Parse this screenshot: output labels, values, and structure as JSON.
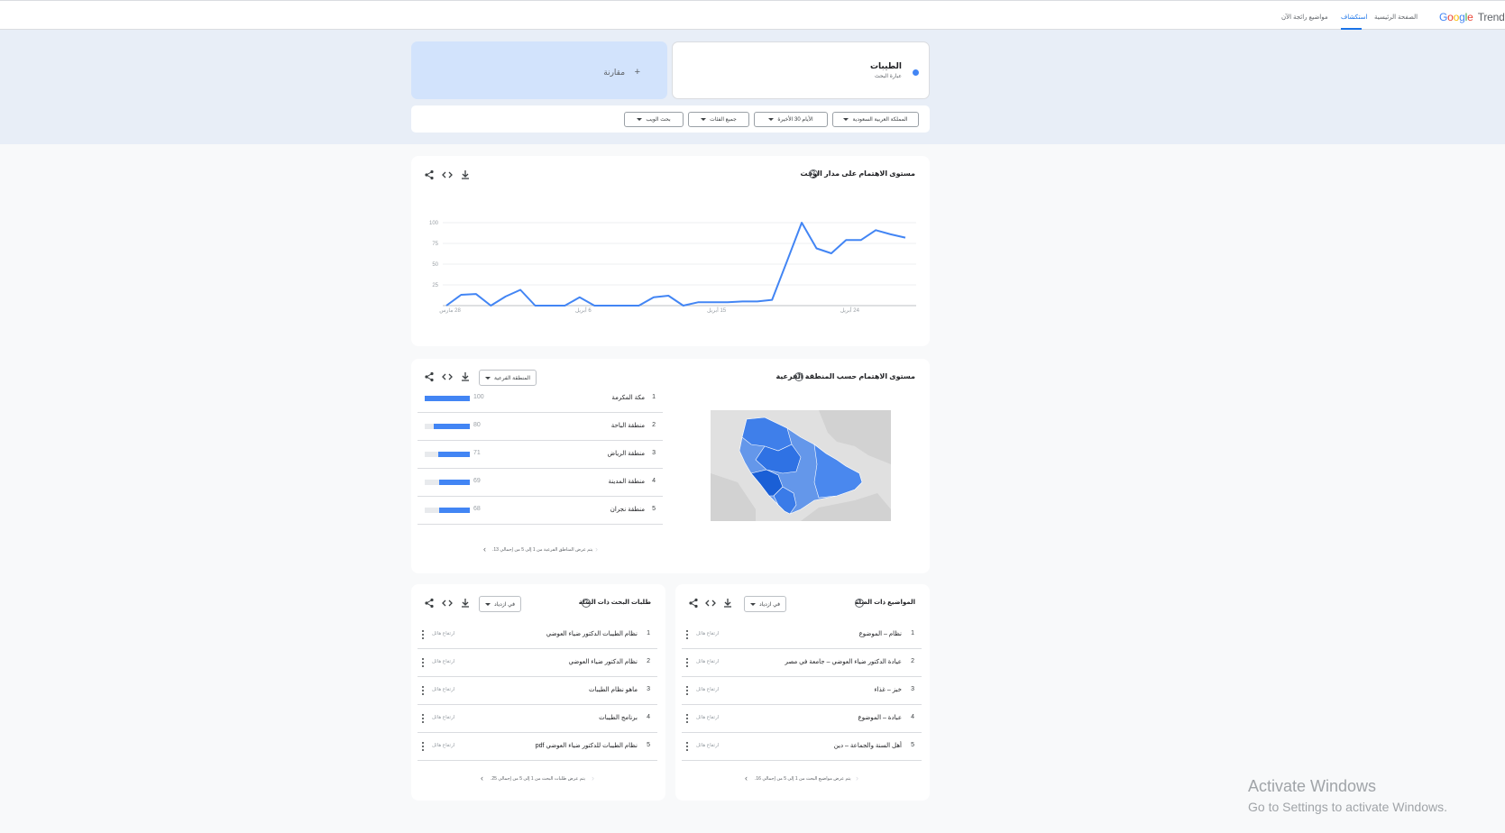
{
  "header": {
    "logo": {
      "google": "Google",
      "trends": "Trends"
    },
    "tabs": [
      {
        "label": "الصفحة الرئيسية"
      },
      {
        "label": "استكشاف",
        "active": true
      },
      {
        "label": "مواضيع رائجة الآن"
      }
    ],
    "accent_color": "#1a73e8"
  },
  "search_term": {
    "name": "الطيبات",
    "subtitle": "عبارة البحث",
    "color": "#4285f4"
  },
  "compare": {
    "icon": "plus-icon",
    "label": "مقارنة"
  },
  "filters": [
    {
      "label": "المملكة العربية السعودية"
    },
    {
      "label": "الأيام 30 الأخيرة"
    },
    {
      "label": "جميع الفئات"
    },
    {
      "label": "بحث الويب"
    }
  ],
  "interest_over_time": {
    "title": "مستوى الاهتمام على مدار الوقت",
    "y_ticks": [
      "100",
      "75",
      "50",
      "25"
    ],
    "x_labels": [
      "28 مارس",
      "6 أبريل",
      "15 أبريل",
      "24 أبريل"
    ]
  },
  "chart_data": {
    "type": "line",
    "title": "مستوى الاهتمام على مدار الوقت",
    "xlabel": "",
    "ylabel": "",
    "ylim": [
      0,
      100
    ],
    "x_tick_labels": [
      "28 مارس",
      "6 أبريل",
      "15 أبريل",
      "24 أبريل"
    ],
    "grid": true,
    "series": [
      {
        "color": "#4285f4",
        "values": [
          0,
          13,
          14,
          0,
          11,
          19,
          0,
          0,
          0,
          10,
          0,
          0,
          0,
          0,
          10,
          12,
          0,
          4,
          4,
          4,
          5,
          5,
          7,
          53,
          100,
          69,
          63,
          79,
          79,
          91,
          86,
          82
        ]
      }
    ]
  },
  "interest_by_region": {
    "title": "مستوى الاهتمام حسب المنطقة الفرعية",
    "dropdown": "المنطقة الفرعية",
    "rows": [
      {
        "rank": "1",
        "name": "مكة المكرمة",
        "value": 100
      },
      {
        "rank": "2",
        "name": "منطقة الباحة",
        "value": 80
      },
      {
        "rank": "3",
        "name": "منطقة الرياض",
        "value": 71
      },
      {
        "rank": "4",
        "name": "منطقة المدينة",
        "value": 69
      },
      {
        "rank": "5",
        "name": "منطقة نجران",
        "value": 68
      }
    ],
    "pager": "يتم عرض المناطق الفرعية من 1 إلى 5 من إجمالي 13."
  },
  "related_topics": {
    "title": "المواضيع ذات الصلة",
    "dropdown": "في ازدياد",
    "rows": [
      {
        "rank": "1",
        "name": "نظام – الموضوع",
        "label": "ارتفاع هائل"
      },
      {
        "rank": "2",
        "name": "عيادة الدكتور ضياء العوضي – جامعة في مصر",
        "label": "ارتفاع هائل"
      },
      {
        "rank": "3",
        "name": "خبز – غذاء",
        "label": "ارتفاع هائل"
      },
      {
        "rank": "4",
        "name": "عبادة – الموضوع",
        "label": "ارتفاع هائل"
      },
      {
        "rank": "5",
        "name": "أهل السنة والجماعة – دين",
        "label": "ارتفاع هائل"
      }
    ],
    "pager": "يتم عرض مواضيع البحث من 1 إلى 5 من إجمالي 16."
  },
  "related_queries": {
    "title": "طلبات البحث ذات الصلة",
    "dropdown": "في ازدياد",
    "rows": [
      {
        "rank": "1",
        "name": "نظام الطيبات الدكتور ضياء العوضي",
        "label": "ارتفاع هائل"
      },
      {
        "rank": "2",
        "name": "نظام الدكتور ضياء العوضي",
        "label": "ارتفاع هائل"
      },
      {
        "rank": "3",
        "name": "ماهو نظام الطيبات",
        "label": "ارتفاع هائل"
      },
      {
        "rank": "4",
        "name": "برنامج الطيبات",
        "label": "ارتفاع هائل"
      },
      {
        "rank": "5",
        "name": "نظام الطيبات للدكتور ضياء العوضي pdf",
        "label": "ارتفاع هائل"
      }
    ],
    "pager": "يتم عرض طلبات البحث من 1 إلى 5 من إجمالي 25."
  },
  "watermark": {
    "line1": "Activate Windows",
    "line2": "Go to Settings to activate Windows."
  }
}
